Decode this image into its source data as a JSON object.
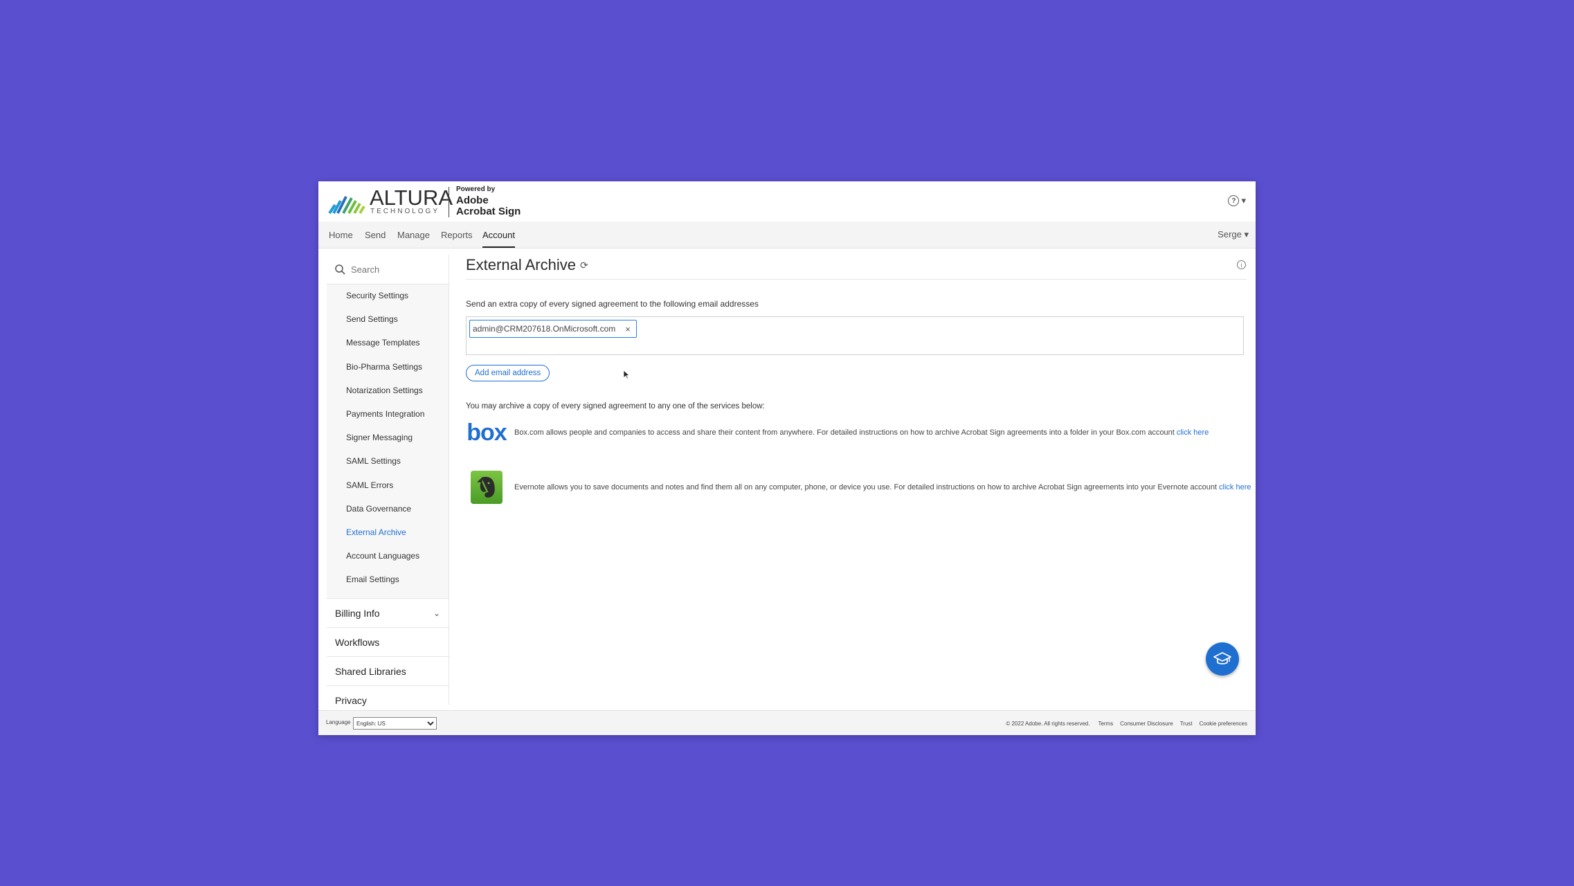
{
  "header": {
    "brand_name": "ALTURA",
    "brand_sub": "TECHNOLOGY",
    "powered_by": "Powered by",
    "product_line1": "Adobe",
    "product_line2": "Acrobat Sign",
    "help_glyph": "?",
    "help_caret": "▾"
  },
  "nav": {
    "items": [
      "Home",
      "Send",
      "Manage",
      "Reports",
      "Account"
    ],
    "active": "Account",
    "user": "Serge ▾"
  },
  "sidebar": {
    "search_placeholder": "Search",
    "sub_items": [
      "Security Settings",
      "Send Settings",
      "Message Templates",
      "Bio-Pharma Settings",
      "Notarization Settings",
      "Payments Integration",
      "Signer Messaging",
      "SAML Settings",
      "SAML Errors",
      "Data Governance",
      "External Archive",
      "Account Languages",
      "Email Settings"
    ],
    "active_item": "External Archive",
    "sections": [
      "Billing Info",
      "Workflows",
      "Shared Libraries",
      "Privacy"
    ]
  },
  "main": {
    "title": "External Archive",
    "refresh_glyph": "⟳",
    "info_glyph": "i",
    "instruction": "Send an extra copy of every signed agreement to the following email addresses",
    "email_chip": "admin@CRM207618.OnMicrosoft.com",
    "chip_remove": "×",
    "add_button": "Add email address",
    "archive_intro": "You may archive a copy of every signed agreement to any one of the services below:",
    "services": [
      {
        "logo": "box",
        "text": "Box.com allows people and companies to access and share their content from anywhere. For detailed instructions on how to archive Acrobat Sign agreements into a folder in your Box.com account",
        "link": "click here"
      },
      {
        "logo": "evernote-icon",
        "text": "Evernote allows you to save documents and notes and find them all on any computer, phone, or device you use. For detailed instructions on how to archive Acrobat Sign agreements into your Evernote account",
        "link": "click here"
      }
    ]
  },
  "footer": {
    "language_label": "Language",
    "language_value": "English: US",
    "copyright": "© 2022 Adobe. All rights reserved.",
    "links": [
      "Terms",
      "Consumer Disclosure",
      "Trust",
      "Cookie preferences"
    ]
  },
  "colors": {
    "background": "#5a4fcf",
    "accent": "#1f6fd1",
    "evernote": "#5aae2e"
  }
}
